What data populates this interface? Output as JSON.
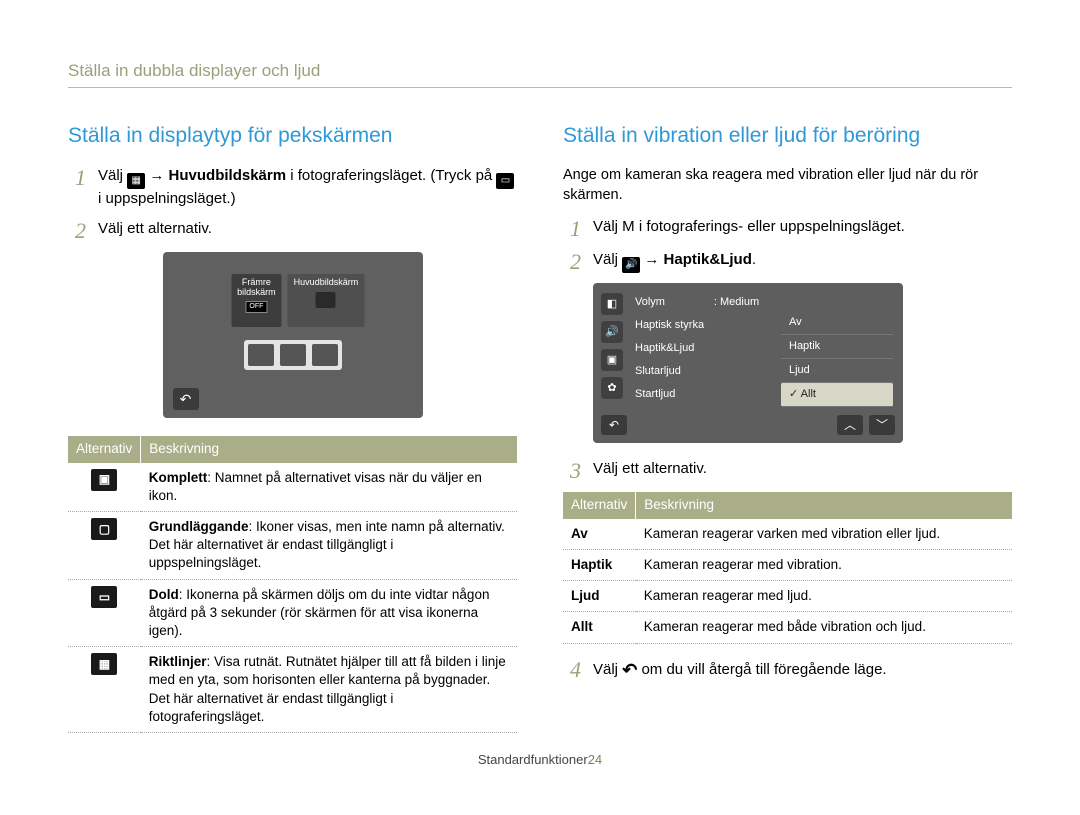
{
  "header": {
    "section_title": "Ställa in dubbla displayer och ljud"
  },
  "left": {
    "title": "Ställa in displaytyp för pekskärmen",
    "steps": {
      "s1_pre": "Välj ",
      "s1_bold": "Huvudbildskärm",
      "s1_post": " i fotograferingsläget. (Tryck på ",
      "s1_post2": " i uppspelningsläget.)",
      "s2": "Välj ett alternativ."
    },
    "shot": {
      "tab1_line1": "Främre",
      "tab1_line2": "bildskärm",
      "tab2": "Huvudbildskärm",
      "off": "OFF"
    },
    "table": {
      "h1": "Alternativ",
      "h2": "Beskrivning",
      "r1_name": "Komplett",
      "r1_desc": ": Namnet på alternativet visas när du väljer en ikon.",
      "r2_name": "Grundläggande",
      "r2_desc": ": Ikoner visas, men inte namn på alternativ. Det här alternativet är endast tillgängligt i uppspelningsläget.",
      "r3_name": "Dold",
      "r3_desc": ": Ikonerna på skärmen döljs om du inte vidtar någon åtgärd på 3 sekunder (rör skärmen för att visa ikonerna igen).",
      "r4_name": "Riktlinjer",
      "r4_desc": ": Visa rutnät. Rutnätet hjälper till att få bilden i linje med en yta, som horisonten eller kanterna på byggnader. Det här alternativet är endast tillgängligt i fotograferingsläget."
    }
  },
  "right": {
    "title": "Ställa in vibration eller ljud för beröring",
    "intro": "Ange om kameran ska reagera med vibration eller ljud när du rör skärmen.",
    "steps": {
      "s1": "Välj M       i fotograferings- eller uppspelningsläget.",
      "s2_pre": "Välj ",
      "s2_bold": "Haptik&Ljud",
      "s2_post": ".",
      "s3": "Välj ett alternativ.",
      "s4_pre": "Välj ",
      "s4_post": " om du vill återgå till föregående läge."
    },
    "menu": {
      "l1": "Volym",
      "v1": ": Medium",
      "l2": "Haptisk styrka",
      "l3": "Haptik&Ljud",
      "l4": "Slutarljud",
      "l5": "Startljud",
      "opt1": "Av",
      "opt2": "Haptik",
      "opt3": "Ljud",
      "opt4": "Allt"
    },
    "table": {
      "h1": "Alternativ",
      "h2": "Beskrivning",
      "r1_k": "Av",
      "r1_v": "Kameran reagerar varken med vibration eller ljud.",
      "r2_k": "Haptik",
      "r2_v": "Kameran reagerar med vibration.",
      "r3_k": "Ljud",
      "r3_v": "Kameran reagerar med ljud.",
      "r4_k": "Allt",
      "r4_v": "Kameran reagerar med både vibration och ljud."
    }
  },
  "footer": {
    "label": "Standardfunktioner",
    "page": "24"
  }
}
